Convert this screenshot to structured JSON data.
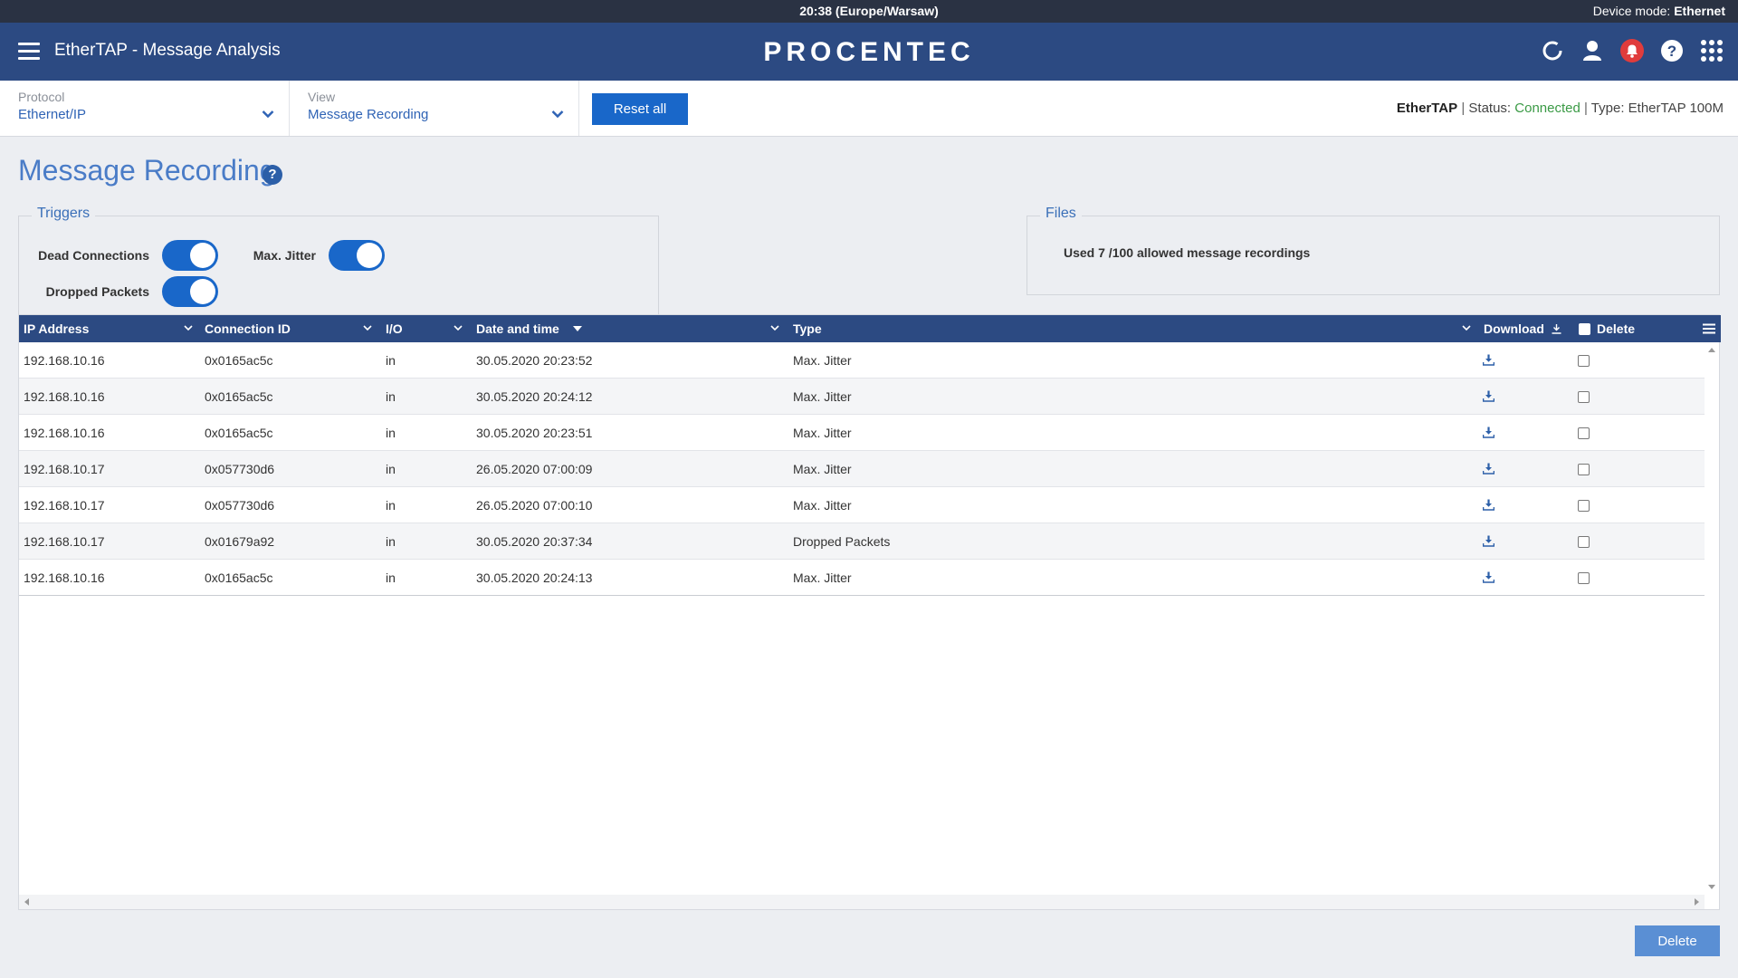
{
  "status_bar": {
    "clock": "20:38 (Europe/Warsaw)",
    "mode_label": "Device mode:",
    "mode_value": "Ethernet"
  },
  "header": {
    "title": "EtherTAP - Message Analysis",
    "brand": "PROCENTEC",
    "icons": [
      "refresh-icon",
      "user-icon",
      "notification-bell-icon",
      "help-icon",
      "apps-grid-icon"
    ],
    "notification_color": "#e03c3c"
  },
  "toolbar": {
    "protocol_label": "Protocol",
    "protocol_value": "Ethernet/IP",
    "view_label": "View",
    "view_value": "Message Recording",
    "reset_label": "Reset all",
    "device_name": "EtherTAP",
    "status_label": "Status:",
    "status_value": "Connected",
    "type_label": "Type:",
    "type_value": "EtherTAP 100M",
    "accent_color": "#1967c9",
    "connected_color": "#3a9a45"
  },
  "page": {
    "title": "Message Recording",
    "help_glyph": "?"
  },
  "triggers": {
    "legend": "Triggers",
    "items": [
      {
        "label": "Dead Connections",
        "on": true
      },
      {
        "label": "Max. Jitter",
        "on": true
      },
      {
        "label": "Dropped Packets",
        "on": true
      }
    ]
  },
  "files": {
    "legend": "Files",
    "usage_text": "Used 7 /100 allowed message recordings"
  },
  "table": {
    "columns": [
      "IP Address",
      "Connection ID",
      "I/O",
      "Date and time",
      "Type",
      "Download",
      "Delete"
    ],
    "rows": [
      {
        "ip": "192.168.10.16",
        "conn": "0x0165ac5c",
        "io": "in",
        "datetime": "30.05.2020 20:23:52",
        "type": "Max. Jitter"
      },
      {
        "ip": "192.168.10.16",
        "conn": "0x0165ac5c",
        "io": "in",
        "datetime": "30.05.2020 20:24:12",
        "type": "Max. Jitter"
      },
      {
        "ip": "192.168.10.16",
        "conn": "0x0165ac5c",
        "io": "in",
        "datetime": "30.05.2020 20:23:51",
        "type": "Max. Jitter"
      },
      {
        "ip": "192.168.10.17",
        "conn": "0x057730d6",
        "io": "in",
        "datetime": "26.05.2020 07:00:09",
        "type": "Max. Jitter"
      },
      {
        "ip": "192.168.10.17",
        "conn": "0x057730d6",
        "io": "in",
        "datetime": "26.05.2020 07:00:10",
        "type": "Max. Jitter"
      },
      {
        "ip": "192.168.10.17",
        "conn": "0x01679a92",
        "io": "in",
        "datetime": "30.05.2020 20:37:34",
        "type": "Dropped Packets"
      },
      {
        "ip": "192.168.10.16",
        "conn": "0x0165ac5c",
        "io": "in",
        "datetime": "30.05.2020 20:24:13",
        "type": "Max. Jitter"
      }
    ]
  },
  "footer": {
    "delete_label": "Delete"
  }
}
